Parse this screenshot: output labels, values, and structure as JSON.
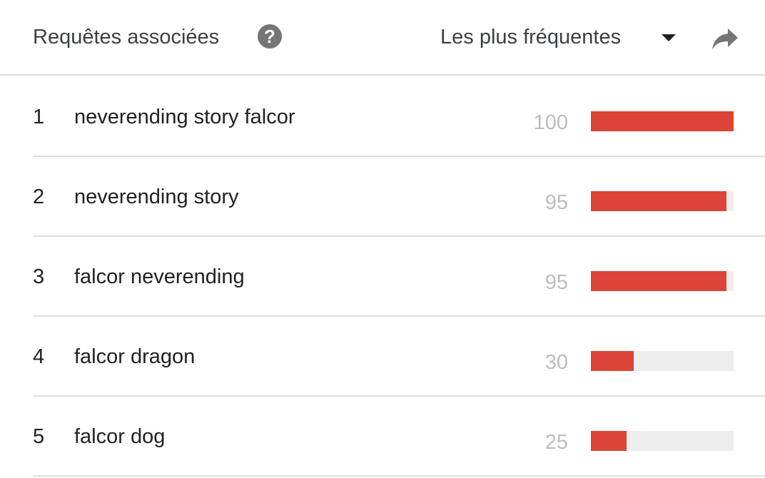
{
  "header": {
    "title": "Requêtes associées",
    "help_icon": "question-circle-icon",
    "sort_label": "Les plus fréquentes",
    "dropdown_icon": "caret-down-icon",
    "share_icon": "share-arrow-icon"
  },
  "rows": [
    {
      "rank": "1",
      "query": "neverending story falcor",
      "value": "100",
      "fraction": 1.0
    },
    {
      "rank": "2",
      "query": "neverending story",
      "value": "95",
      "fraction": 0.95
    },
    {
      "rank": "3",
      "query": "falcor neverending",
      "value": "95",
      "fraction": 0.95
    },
    {
      "rank": "4",
      "query": "falcor dragon",
      "value": "30",
      "fraction": 0.3
    },
    {
      "rank": "5",
      "query": "falcor dog",
      "value": "25",
      "fraction": 0.25
    }
  ],
  "colors": {
    "bar_fill": "#db4437",
    "bar_track": "#eeeeee",
    "value_text": "#bdbdbd"
  }
}
